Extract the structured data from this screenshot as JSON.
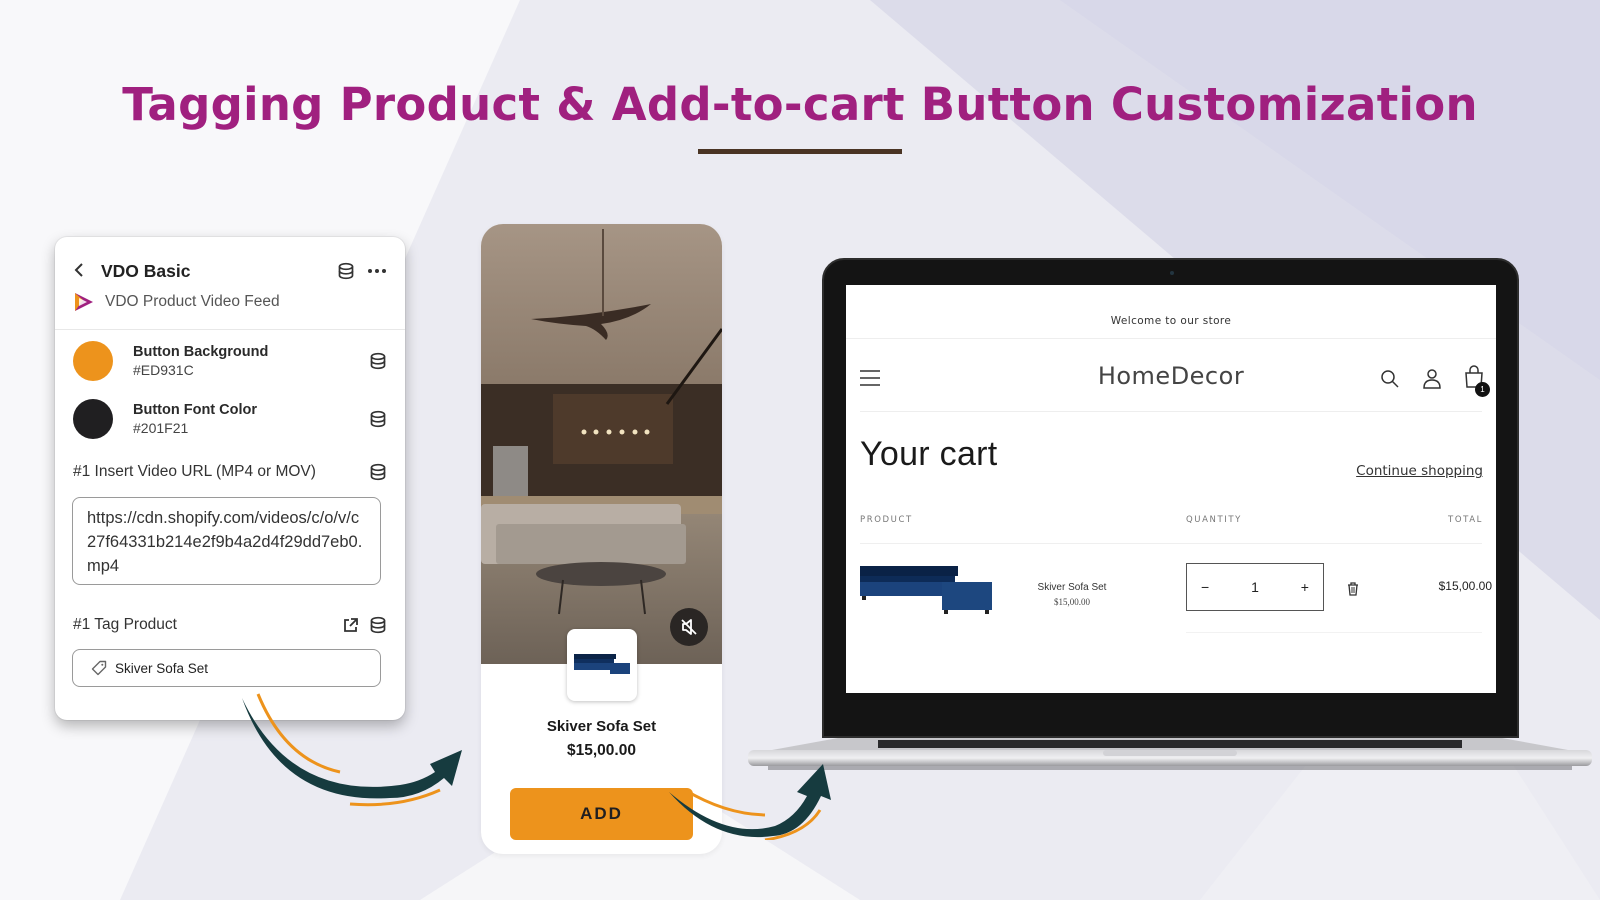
{
  "banner": {
    "title": "Tagging Product & Add-to-cart Button Customization",
    "colors": {
      "title": "#a0207f",
      "rule": "#4a3424",
      "arrow_dark": "#163b3f",
      "arrow_accent": "#ED931C"
    }
  },
  "settings_panel": {
    "back_icon": "chevron-left-icon",
    "title": "VDO Basic",
    "header_icons": [
      "database-icon",
      "more-horizontal-icon"
    ],
    "app_icon": "vdo-play-logo-icon",
    "app_name": "VDO Product Video Feed",
    "color_settings": [
      {
        "label": "Button Background",
        "value": "#ED931C",
        "swatch": "#ED931C",
        "icon": "database-icon"
      },
      {
        "label": "Button Font Color",
        "value": "#201F21",
        "swatch": "#201F21",
        "icon": "database-icon"
      }
    ],
    "video_url": {
      "label": "#1 Insert Video URL (MP4 or MOV)",
      "value": "https://cdn.shopify.com/videos/c/o/v/c27f64331b214e2f9b4a2d4f29dd7eb0.mp4",
      "icon": "database-icon"
    },
    "tag_product": {
      "label": "#1 Tag Product",
      "icons": [
        "external-link-icon",
        "database-icon"
      ],
      "value": "Skiver Sofa Set",
      "value_icon": "tag-icon"
    }
  },
  "video_card": {
    "mute_icon": "speaker-muted-icon",
    "product_name": "Skiver Sofa Set",
    "product_price": "$15,00.00",
    "add_button": "ADD",
    "button_bg": "#ED931C",
    "button_fg": "#201F21"
  },
  "storefront": {
    "announcement": "Welcome to our store",
    "store_name": "HomeDecor",
    "header_icons": [
      "menu-icon",
      "search-icon",
      "account-icon",
      "cart-icon"
    ],
    "cart_count": "1",
    "page_title": "Your cart",
    "continue_link": "Continue shopping",
    "columns": {
      "product": "PRODUCT",
      "quantity": "QUANTITY",
      "total": "TOTAL"
    },
    "items": [
      {
        "name": "Skiver Sofa Set",
        "price": "$15,00.00",
        "quantity": "1",
        "minus": "−",
        "plus": "+",
        "total": "$15,00.00"
      }
    ]
  }
}
